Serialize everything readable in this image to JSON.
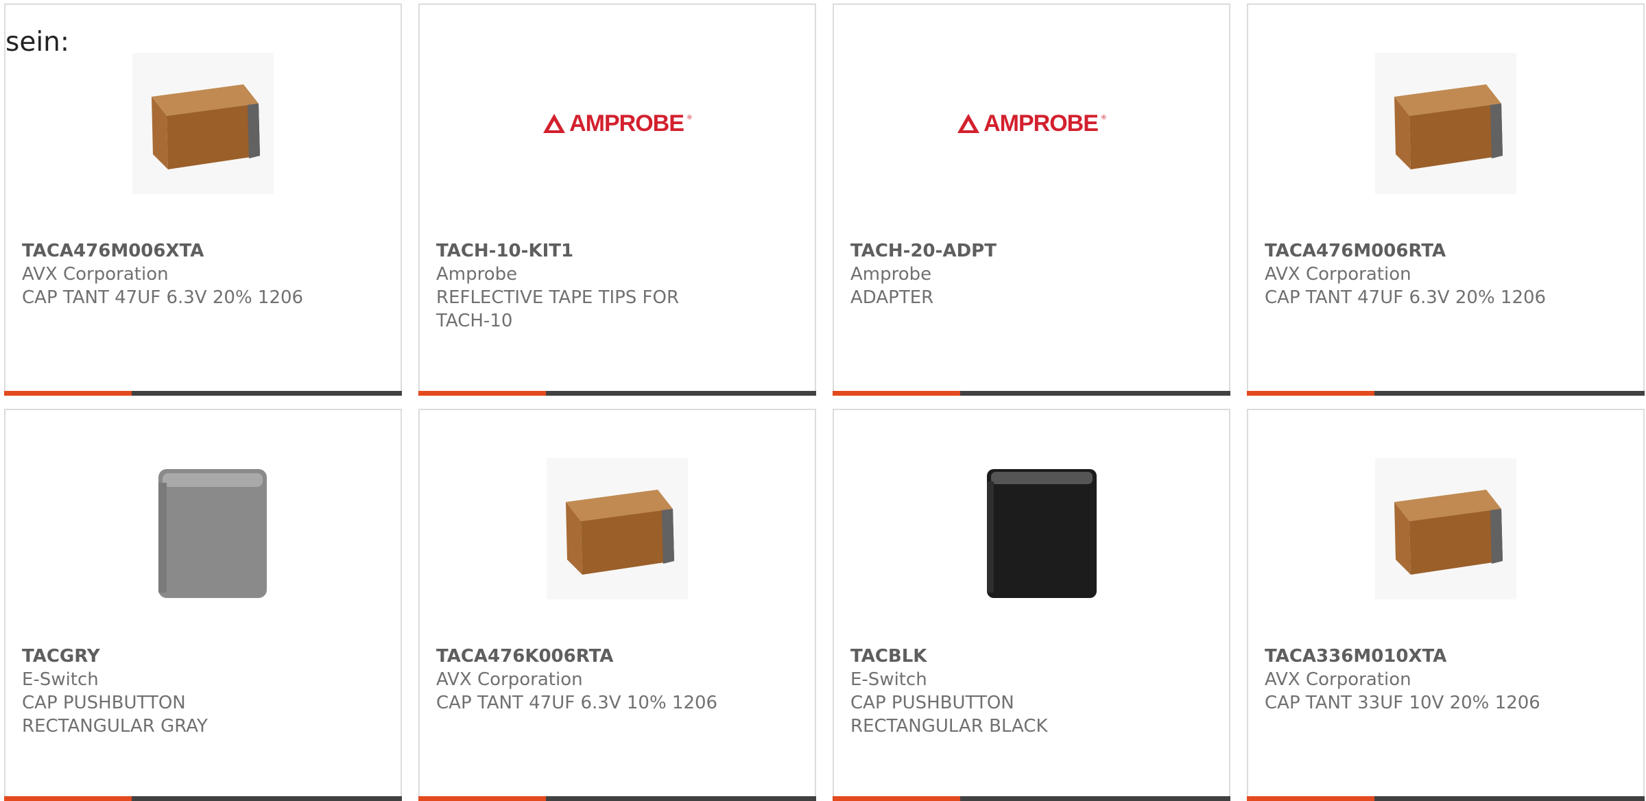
{
  "intro_text": "sein:",
  "colors": {
    "card_border": "#dcdcdc",
    "progress_accent": "#e34a1e",
    "progress_track": "#414141",
    "part_number": "#5e5e5e",
    "secondary_text": "#707070",
    "amprobe_red": "#d3202e"
  },
  "products": [
    {
      "part_number": "TACA476M006XTA",
      "manufacturer": "AVX Corporation",
      "description": "CAP TANT 47UF 6.3V 20% 1206",
      "image": "tantalum-capacitor-image",
      "progress_fraction": 0.32
    },
    {
      "part_number": "TACH-10-KIT1",
      "manufacturer": "Amprobe",
      "description": "REFLECTIVE TAPE TIPS FOR TACH-10",
      "image": "amprobe-logo",
      "logo_text": "AMPROBE",
      "progress_fraction": 0.32
    },
    {
      "part_number": "TACH-20-ADPT",
      "manufacturer": "Amprobe",
      "description": "ADAPTER",
      "image": "amprobe-logo",
      "logo_text": "AMPROBE",
      "progress_fraction": 0.32
    },
    {
      "part_number": "TACA476M006RTA",
      "manufacturer": "AVX Corporation",
      "description": "CAP TANT 47UF 6.3V 20% 1206",
      "image": "tantalum-capacitor-image",
      "progress_fraction": 0.32
    },
    {
      "part_number": "TACGRY",
      "manufacturer": "E-Switch",
      "description": "CAP PUSHBUTTON RECTANGULAR GRAY",
      "image": "gray-pushbutton-cap-image",
      "progress_fraction": 0.32
    },
    {
      "part_number": "TACA476K006RTA",
      "manufacturer": "AVX Corporation",
      "description": "CAP TANT 47UF 6.3V 10% 1206",
      "image": "tantalum-capacitor-image",
      "progress_fraction": 0.32
    },
    {
      "part_number": "TACBLK",
      "manufacturer": "E-Switch",
      "description": "CAP PUSHBUTTON RECTANGULAR BLACK",
      "image": "black-pushbutton-cap-image",
      "progress_fraction": 0.32
    },
    {
      "part_number": "TACA336M010XTA",
      "manufacturer": "AVX Corporation",
      "description": "CAP TANT 33UF 10V 20% 1206",
      "image": "tantalum-capacitor-image",
      "progress_fraction": 0.32
    }
  ]
}
